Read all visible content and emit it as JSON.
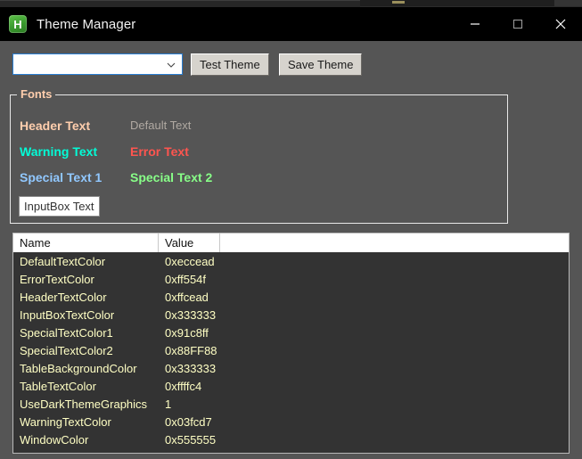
{
  "window": {
    "title": "Theme Manager",
    "icon": "app-icon-h",
    "icon_letter": "H",
    "background_color": "#555555",
    "titlebar_color": "#000000",
    "controls": {
      "minimize": "minimize-icon",
      "maximize": "maximize-icon",
      "close": "close-icon"
    }
  },
  "toolbar": {
    "theme_select": {
      "value": "",
      "placeholder": "",
      "arrow": "chevron-down-icon"
    },
    "test_theme_label": "Test Theme",
    "save_theme_label": "Save Theme"
  },
  "fonts_group": {
    "legend": "Fonts",
    "samples": [
      {
        "name": "header-text",
        "label": "Header Text",
        "color": "#ffcead"
      },
      {
        "name": "default-text",
        "label": "Default Text",
        "color": "#eccead"
      },
      {
        "name": "warning-text",
        "label": "Warning Text",
        "color": "#03fcd7"
      },
      {
        "name": "error-text",
        "label": "Error Text",
        "color": "#ff554f"
      },
      {
        "name": "special-text-1",
        "label": "Special Text 1",
        "color": "#91c8ff"
      },
      {
        "name": "special-text-2",
        "label": "Special Text 2",
        "color": "#88ff88"
      }
    ],
    "inputbox": {
      "value": "InputBox Text",
      "text_color": "#333333",
      "background_color": "#ffffff"
    }
  },
  "table": {
    "columns": [
      "Name",
      "Value",
      ""
    ],
    "background_color": "#333333",
    "text_color": "#ffffc4",
    "rows": [
      {
        "name": "DefaultTextColor",
        "value": "0xeccead"
      },
      {
        "name": "ErrorTextColor",
        "value": "0xff554f"
      },
      {
        "name": "HeaderTextColor",
        "value": "0xffcead"
      },
      {
        "name": "InputBoxTextColor",
        "value": "0x333333"
      },
      {
        "name": "SpecialTextColor1",
        "value": "0x91c8ff"
      },
      {
        "name": "SpecialTextColor2",
        "value": "0x88FF88"
      },
      {
        "name": "TableBackgroundColor",
        "value": "0x333333"
      },
      {
        "name": "TableTextColor",
        "value": "0xffffc4"
      },
      {
        "name": "UseDarkThemeGraphics",
        "value": "1"
      },
      {
        "name": "WarningTextColor",
        "value": "0x03fcd7"
      },
      {
        "name": "WindowColor",
        "value": "0x555555"
      }
    ]
  }
}
